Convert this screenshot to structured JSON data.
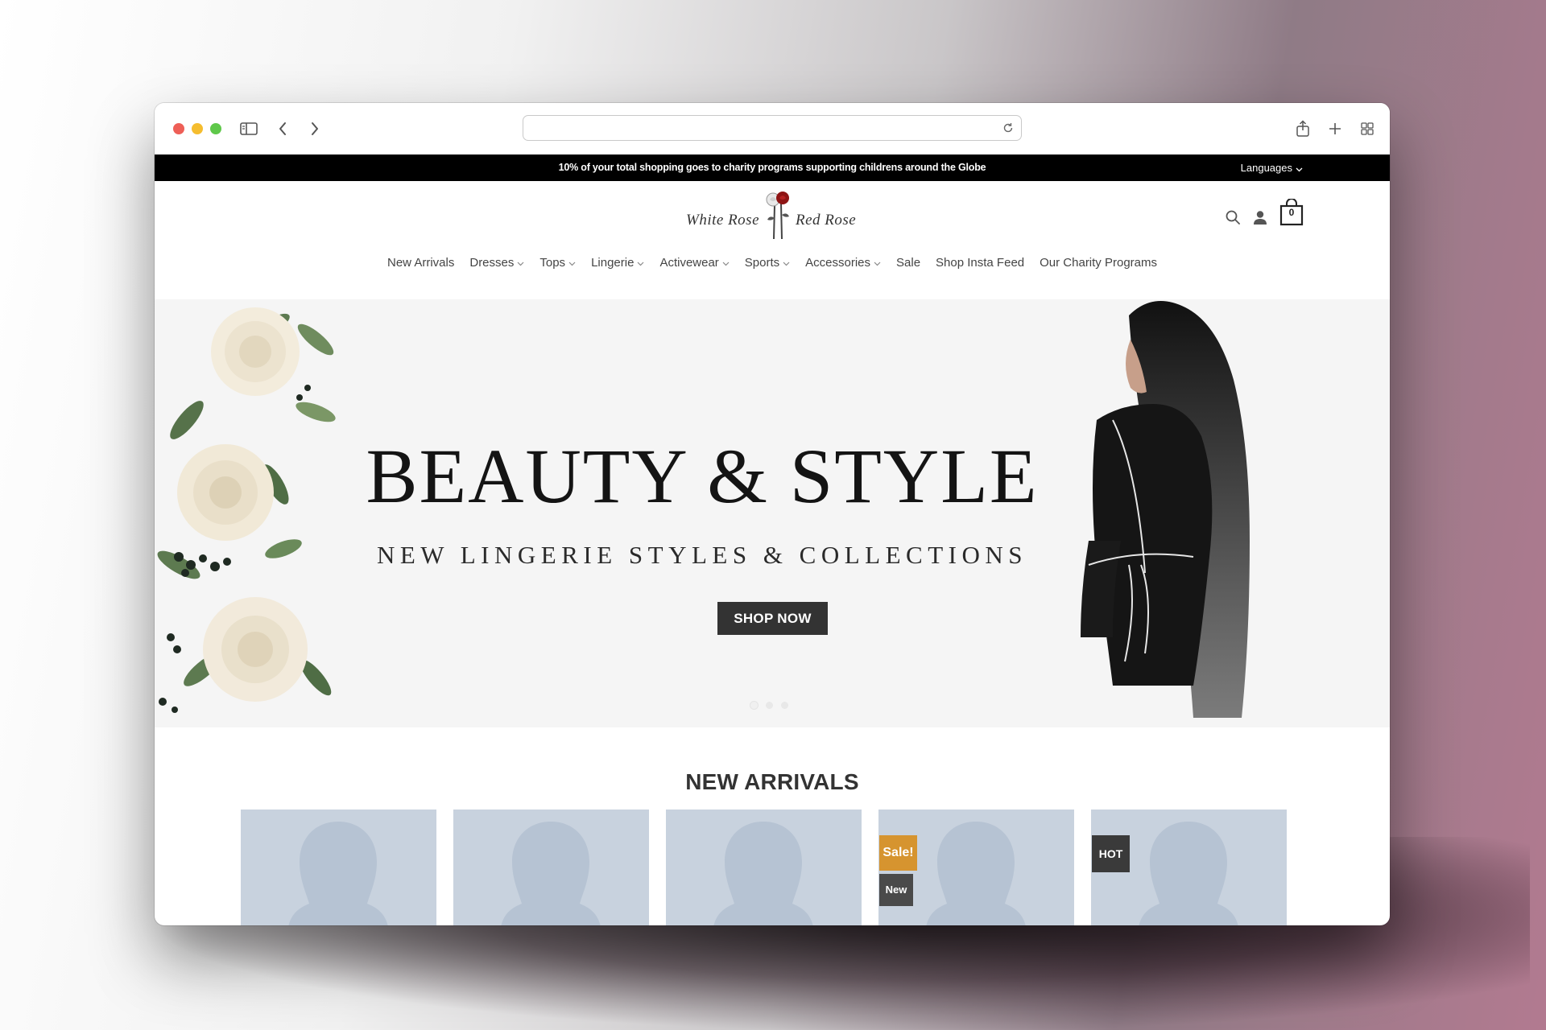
{
  "announcement": {
    "text": "10% of your total shopping goes to charity programs supporting childrens around the Globe",
    "languages_label": "Languages"
  },
  "logo": {
    "left_text": "White Rose",
    "right_text": "Red Rose"
  },
  "header": {
    "cart_count": "0"
  },
  "nav": {
    "items": [
      {
        "label": "New Arrivals",
        "has_dropdown": false
      },
      {
        "label": "Dresses",
        "has_dropdown": true
      },
      {
        "label": "Tops",
        "has_dropdown": true
      },
      {
        "label": "Lingerie",
        "has_dropdown": true
      },
      {
        "label": "Activewear",
        "has_dropdown": true
      },
      {
        "label": "Sports",
        "has_dropdown": true
      },
      {
        "label": "Accessories",
        "has_dropdown": true
      },
      {
        "label": "Sale",
        "has_dropdown": false
      },
      {
        "label": "Shop Insta Feed",
        "has_dropdown": false
      },
      {
        "label": "Our Charity Programs",
        "has_dropdown": false
      }
    ]
  },
  "hero": {
    "title": "BEAUTY & STYLE",
    "subtitle": "NEW LINGERIE STYLES & COLLECTIONS",
    "cta_label": "SHOP NOW"
  },
  "new_arrivals": {
    "title": "NEW ARRIVALS",
    "products": [
      {
        "badges": []
      },
      {
        "badges": []
      },
      {
        "badges": []
      },
      {
        "badges": [
          "Sale!",
          "New"
        ]
      },
      {
        "badges": [
          "HOT"
        ]
      }
    ]
  },
  "colors": {
    "sale_badge": "#d6942f",
    "dark_badge": "#4a4a4a",
    "button": "#333333",
    "placeholder": "#c8d2de"
  }
}
